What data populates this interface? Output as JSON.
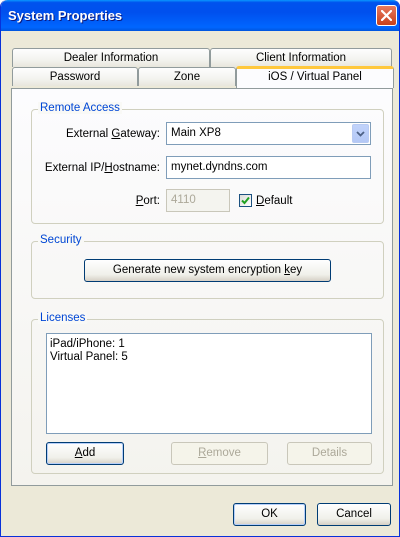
{
  "window": {
    "title": "System Properties"
  },
  "tabs": {
    "row_back": [
      "Dealer Information",
      "Client Information"
    ],
    "row_front": [
      "Password",
      "Zone",
      "iOS / Virtual Panel"
    ]
  },
  "remote_access": {
    "group_label": "Remote Access",
    "gateway_label": "External Gateway:",
    "gateway_value": "Main XP8",
    "ip_label": "External IP/Hostname:",
    "ip_value": "mynet.dyndns.com",
    "port_label": "Port:",
    "port_value": "4110",
    "default_label": "Default",
    "default_checked": true
  },
  "security": {
    "group_label": "Security",
    "generate_key_label": "Generate new system encryption key"
  },
  "licenses": {
    "group_label": "Licenses",
    "items": [
      "iPad/iPhone: 1",
      "Virtual Panel: 5"
    ],
    "add_label": "Add",
    "remove_label": "Remove",
    "details_label": "Details"
  },
  "footer": {
    "ok_label": "OK",
    "cancel_label": "Cancel"
  }
}
